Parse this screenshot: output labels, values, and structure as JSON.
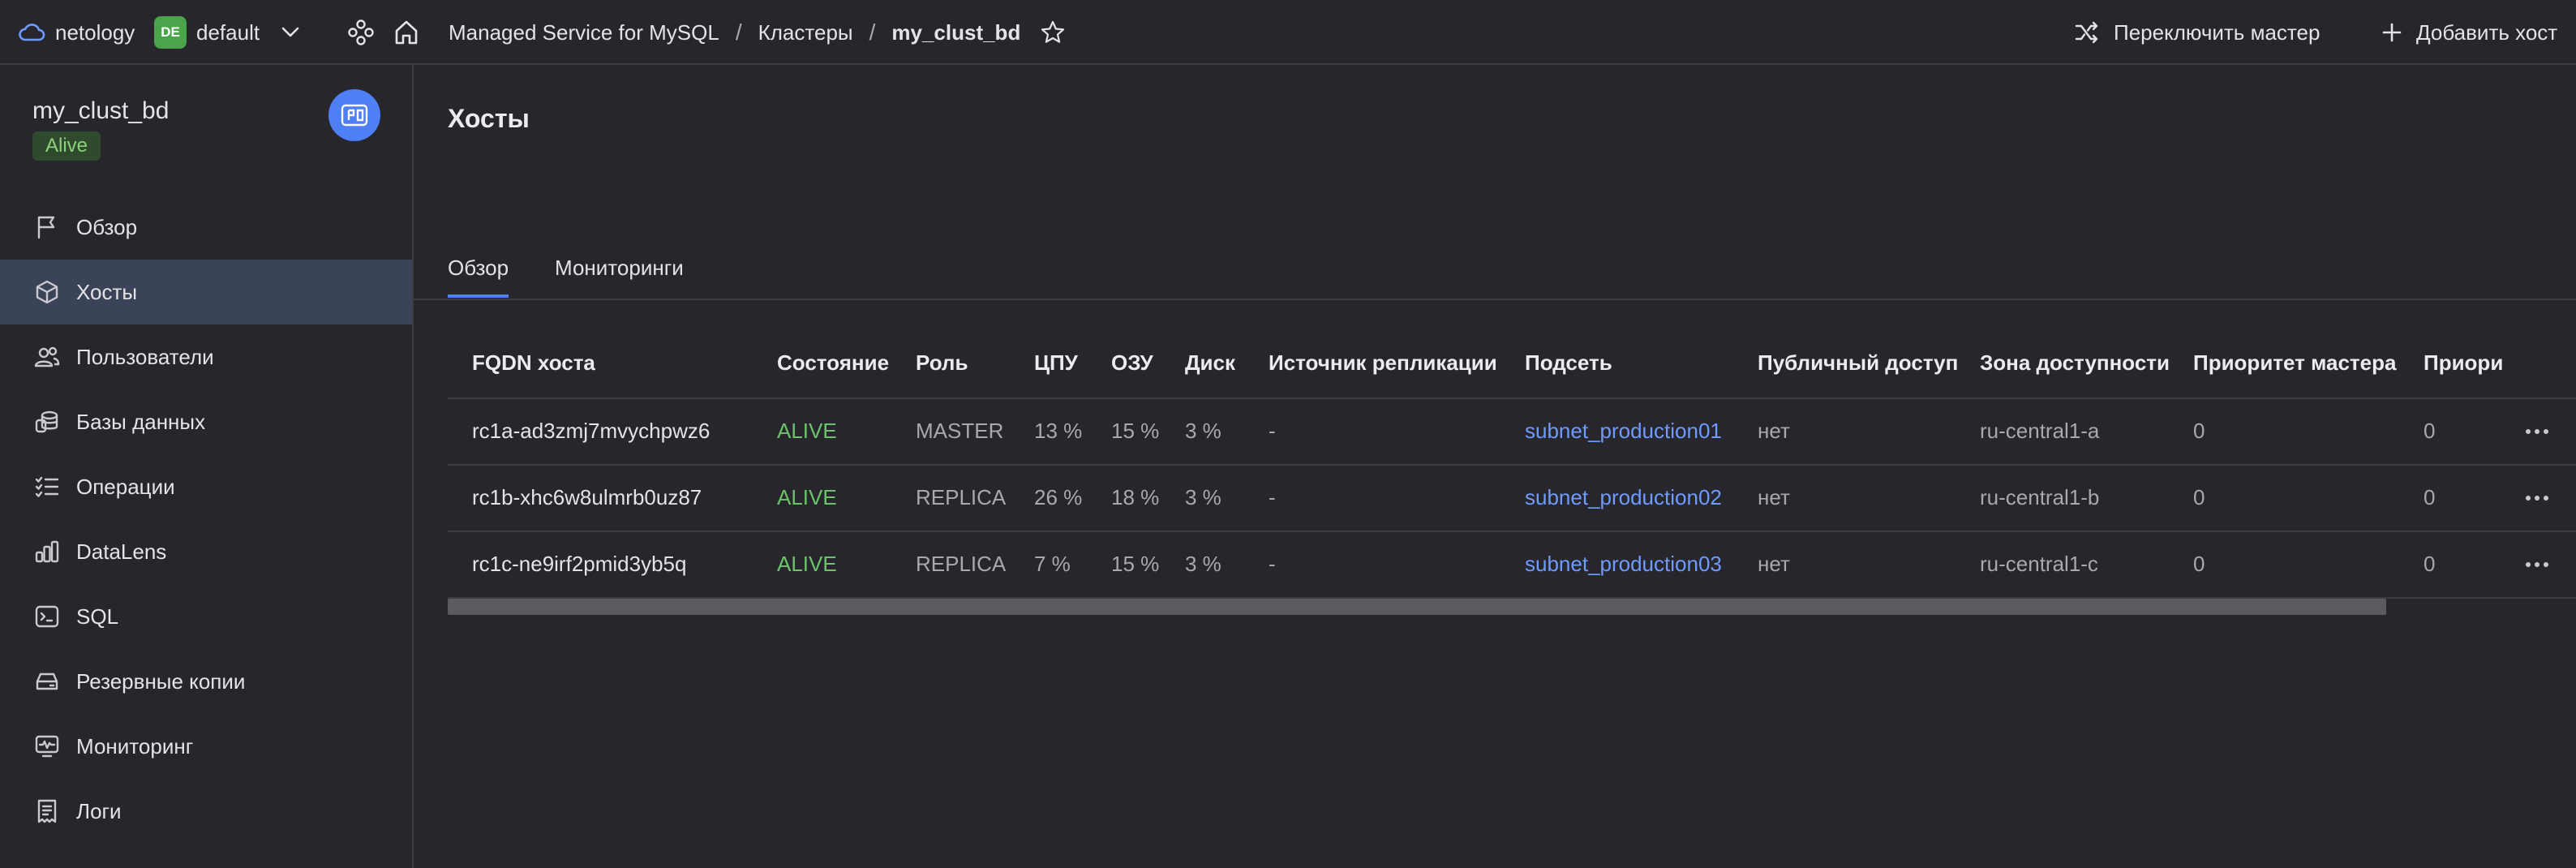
{
  "topbar": {
    "org_name": "netology",
    "folder_badge": "DE",
    "folder_name": "default",
    "breadcrumb": [
      "Managed Service for MySQL",
      "Кластеры",
      "my_clust_bd"
    ],
    "breadcrumb_separator": "/",
    "actions": {
      "switch_master": "Переключить мастер",
      "add_host": "Добавить хост"
    }
  },
  "sidebar": {
    "cluster_name": "my_clust_bd",
    "status": "Alive",
    "items": [
      {
        "label": "Обзор",
        "icon": "flag-icon"
      },
      {
        "label": "Хосты",
        "icon": "cube-icon",
        "active": true
      },
      {
        "label": "Пользователи",
        "icon": "users-icon"
      },
      {
        "label": "Базы данных",
        "icon": "database-icon"
      },
      {
        "label": "Операции",
        "icon": "list-checks-icon"
      },
      {
        "label": "DataLens",
        "icon": "bar-chart-icon"
      },
      {
        "label": "SQL",
        "icon": "terminal-icon"
      },
      {
        "label": "Резервные копии",
        "icon": "backup-drive-icon"
      },
      {
        "label": "Мониторинг",
        "icon": "monitor-pulse-icon"
      },
      {
        "label": "Логи",
        "icon": "receipt-icon"
      }
    ]
  },
  "main": {
    "title": "Хосты",
    "tabs": [
      {
        "label": "Обзор",
        "active": true
      },
      {
        "label": "Мониторинги",
        "active": false
      }
    ],
    "table": {
      "columns": [
        "FQDN хоста",
        "Состояние",
        "Роль",
        "ЦПУ",
        "ОЗУ",
        "Диск",
        "Источник репликации",
        "Подсеть",
        "Публичный доступ",
        "Зона доступности",
        "Приоритет мастера",
        "Приори"
      ],
      "rows": [
        [
          "rc1a-ad3zmj7mvychpwz6",
          "ALIVE",
          "MASTER",
          "13 %",
          "15 %",
          "3 %",
          "-",
          "subnet_production01",
          "нет",
          "ru-central1-a",
          "0",
          "0"
        ],
        [
          "rc1b-xhc6w8ulmrb0uz87",
          "ALIVE",
          "REPLICA",
          "26 %",
          "18 %",
          "3 %",
          "-",
          "subnet_production02",
          "нет",
          "ru-central1-b",
          "0",
          "0"
        ],
        [
          "rc1c-ne9irf2pmid3yb5q",
          "ALIVE",
          "REPLICA",
          "7 %",
          "15 %",
          "3 %",
          "-",
          "subnet_production03",
          "нет",
          "ru-central1-c",
          "0",
          "0"
        ]
      ]
    }
  },
  "colors": {
    "background": "#26262c",
    "accent": "#4f7ff5",
    "alive": "#6cc36a",
    "link": "#6f9bff",
    "folder_badge": "#4aa44a"
  }
}
